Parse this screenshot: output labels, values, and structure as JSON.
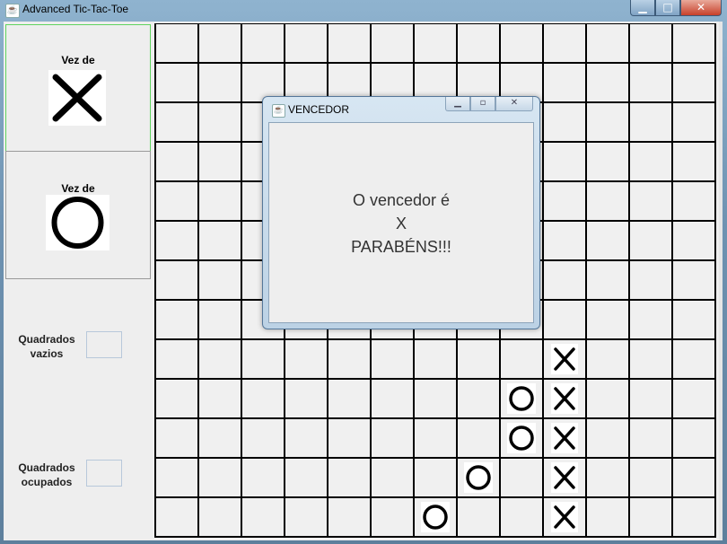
{
  "window": {
    "title": "Advanced Tic-Tac-Toe",
    "icon": "java-cup-icon",
    "controls": {
      "minimize": "▁",
      "maximize": "□",
      "close": "✕"
    }
  },
  "left_panel": {
    "player1": {
      "label": "Vez de",
      "symbol": "X"
    },
    "player2": {
      "label": "Vez de",
      "symbol": "O"
    },
    "empty_squares": {
      "line1": "Quadrados",
      "line2": "vazios",
      "value": ""
    },
    "occupied_squares": {
      "line1": "Quadrados",
      "line2": "ocupados",
      "value": ""
    }
  },
  "board": {
    "columns": 13,
    "rows": 13,
    "marks": [
      {
        "row": 8,
        "col": 9,
        "symbol": "X"
      },
      {
        "row": 9,
        "col": 8,
        "symbol": "O"
      },
      {
        "row": 9,
        "col": 9,
        "symbol": "X"
      },
      {
        "row": 10,
        "col": 8,
        "symbol": "O"
      },
      {
        "row": 10,
        "col": 9,
        "symbol": "X"
      },
      {
        "row": 11,
        "col": 7,
        "symbol": "O"
      },
      {
        "row": 11,
        "col": 9,
        "symbol": "X"
      },
      {
        "row": 12,
        "col": 6,
        "symbol": "O"
      },
      {
        "row": 12,
        "col": 9,
        "symbol": "X"
      }
    ]
  },
  "dialog": {
    "title": "VENCEDOR",
    "icon": "java-cup-icon",
    "controls": {
      "minimize": "▁",
      "maximize": "▫",
      "close": "✕"
    },
    "line1": "O vencedor é",
    "line2": "X",
    "line3": "PARABÉNS!!!"
  },
  "colors": {
    "active_player_border": "#5fd35f",
    "grid_line": "#000000"
  }
}
